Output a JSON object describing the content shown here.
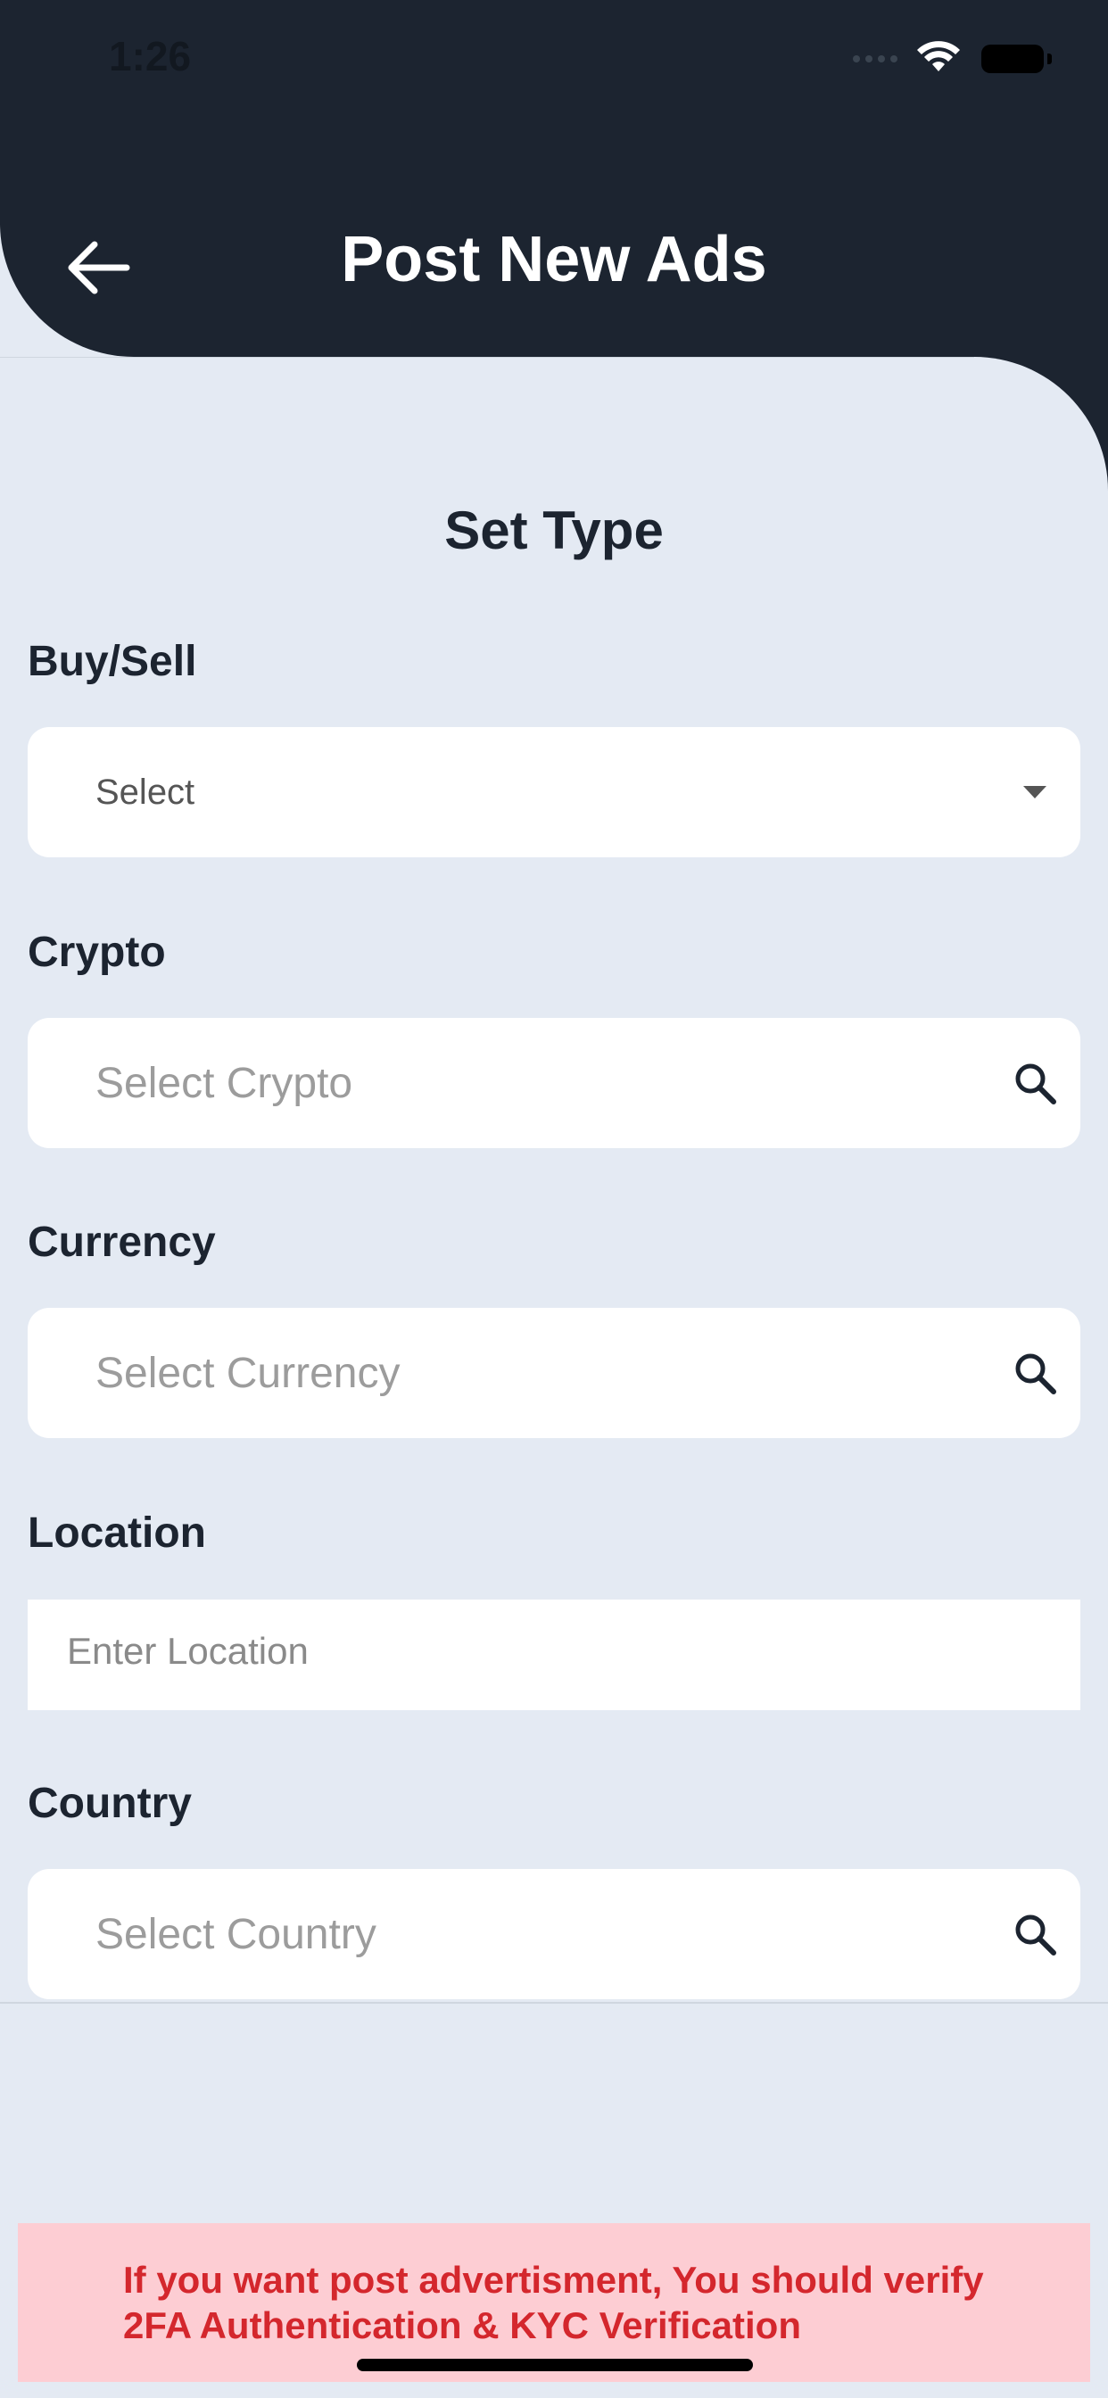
{
  "status_bar": {
    "time": "1:26"
  },
  "header": {
    "title": "Post New Ads"
  },
  "section": {
    "title": "Set Type"
  },
  "form": {
    "buy_sell": {
      "label": "Buy/Sell",
      "value": "Select"
    },
    "crypto": {
      "label": "Crypto",
      "placeholder": "Select Crypto"
    },
    "currency": {
      "label": "Currency",
      "placeholder": "Select Currency"
    },
    "location": {
      "label": "Location",
      "placeholder": "Enter Location"
    },
    "country": {
      "label": "Country",
      "placeholder": "Select Country"
    }
  },
  "warning": {
    "text": "If you want post advertisment, You should verify 2FA Authentication & KYC Verification"
  },
  "icons": [
    "back-arrow-icon",
    "search-icon",
    "chevron-down-icon",
    "wifi-icon",
    "battery-icon"
  ],
  "colors": {
    "header_bg": "#1c2430",
    "page_bg": "#e4eaf3",
    "warning_bg": "#fdcdd3",
    "warning_text": "#d4272d"
  }
}
